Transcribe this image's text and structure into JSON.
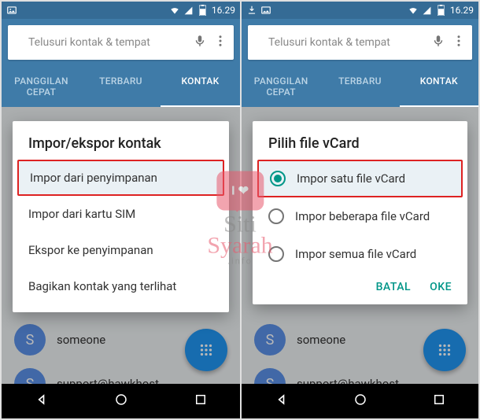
{
  "statusbar": {
    "time": "16.29"
  },
  "search": {
    "placeholder": "Telusuri kontak & tempat"
  },
  "tabs": {
    "t0": "PANGGILAN CEPAT",
    "t1": "TERBARU",
    "t2": "KONTAK"
  },
  "contacts": {
    "c0": {
      "initial": "S",
      "name": "someone"
    },
    "c1": {
      "initial": "S",
      "name": "support@hawkhost..."
    }
  },
  "dialog_left": {
    "title": "Impor/ekspor kontak",
    "o0": "Impor dari penyimpanan",
    "o1": "Impor dari kartu SIM",
    "o2": "Ekspor ke penyimpanan",
    "o3": "Bagikan kontak yang terlihat"
  },
  "dialog_right": {
    "title": "Pilih file vCard",
    "o0": "Impor satu file vCard",
    "o1": "Impor beberapa file vCard",
    "o2": "Impor semua file vCard",
    "cancel": "BATAL",
    "ok": "OKE"
  },
  "watermark": {
    "heart": "I ❤",
    "l1": "Siti",
    "l2": "Syarah",
    "info": ".info"
  }
}
